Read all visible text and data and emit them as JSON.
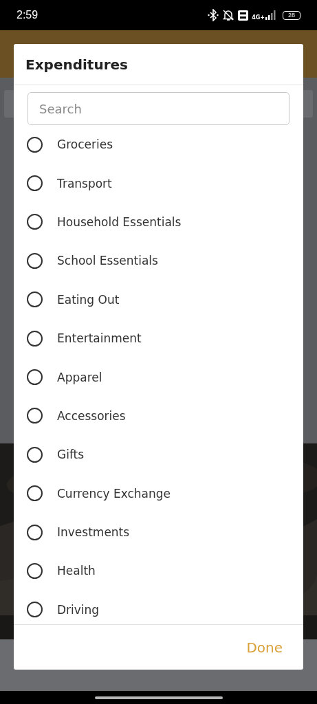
{
  "status_bar": {
    "time": "2:59",
    "network": "4G+",
    "battery": "28"
  },
  "dialog": {
    "title": "Expenditures",
    "search": {
      "placeholder": "Search"
    },
    "options": [
      {
        "label": "Groceries",
        "selected": false
      },
      {
        "label": "Transport",
        "selected": false
      },
      {
        "label": "Household Essentials",
        "selected": false
      },
      {
        "label": "School Essentials",
        "selected": false
      },
      {
        "label": "Eating Out",
        "selected": false
      },
      {
        "label": "Entertainment",
        "selected": false
      },
      {
        "label": "Apparel",
        "selected": false
      },
      {
        "label": "Accessories",
        "selected": false
      },
      {
        "label": "Gifts",
        "selected": false
      },
      {
        "label": "Currency Exchange",
        "selected": false
      },
      {
        "label": "Investments",
        "selected": false
      },
      {
        "label": "Health",
        "selected": false
      },
      {
        "label": "Driving",
        "selected": false
      }
    ],
    "button": "Done"
  }
}
